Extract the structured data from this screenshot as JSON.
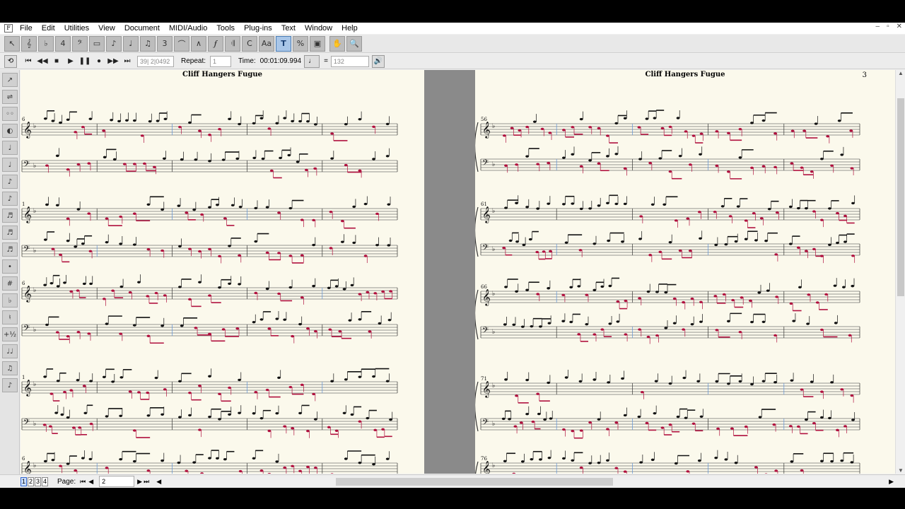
{
  "menu": [
    "File",
    "Edit",
    "Utilities",
    "View",
    "Document",
    "MIDI/Audio",
    "Tools",
    "Plug-ins",
    "Text",
    "Window",
    "Help"
  ],
  "window_controls": [
    "–",
    "▫",
    "✕"
  ],
  "toolbar_icons": [
    "selection-tool-icon",
    "staff-tool-icon",
    "key-sig-tool-icon",
    "time-sig-tool-icon",
    "clef-tool-icon",
    "measure-tool-icon",
    "simple-entry-icon",
    "speedy-entry-icon",
    "hyperscribe-icon",
    "tuplet-tool-icon",
    "smart-shape-icon",
    "articulation-icon",
    "expression-icon",
    "repeat-tool-icon",
    "chord-tool-icon",
    "lyrics-tool-icon",
    "text-tool-icon",
    "resize-tool-icon",
    "graphics-tool-icon",
    "hand-grabber-icon",
    "zoom-tool-icon"
  ],
  "playback": {
    "position": "39| 2|0492",
    "repeat_label": "Repeat:",
    "repeat_value": "1",
    "time_label": "Time:",
    "time_value": "00:01:09.994",
    "equals": "=",
    "tempo": "132"
  },
  "pages": [
    {
      "title": "Cliff Hangers Fugue",
      "number": ""
    },
    {
      "title": "Cliff Hangers Fugue",
      "number": "3"
    }
  ],
  "left_systems": [
    {
      "measure": "6"
    },
    {
      "measure": "1"
    },
    {
      "measure": "6"
    },
    {
      "measure": "1"
    },
    {
      "measure": "6"
    }
  ],
  "right_systems": [
    {
      "measure": "56"
    },
    {
      "measure": "61"
    },
    {
      "measure": "66"
    },
    {
      "measure": "71"
    },
    {
      "measure": "76"
    }
  ],
  "left_palette": [
    "↗",
    "⇌",
    "◦◦",
    "◐",
    "♩",
    "♩",
    "♪",
    "♪",
    "♬",
    "♬",
    "♬",
    "•",
    "#",
    "♭",
    "♮",
    "+½",
    "♩♩",
    "♫",
    "♪"
  ],
  "status": {
    "page_tabs": [
      "1",
      "2",
      "3",
      "4"
    ],
    "page_label": "Page:",
    "page_value": "2"
  },
  "colors": {
    "paper": "#fbf9ec",
    "notes_black": "#111111",
    "notes_red": "#b0103e",
    "barline_blue": "#5b8fd6"
  }
}
